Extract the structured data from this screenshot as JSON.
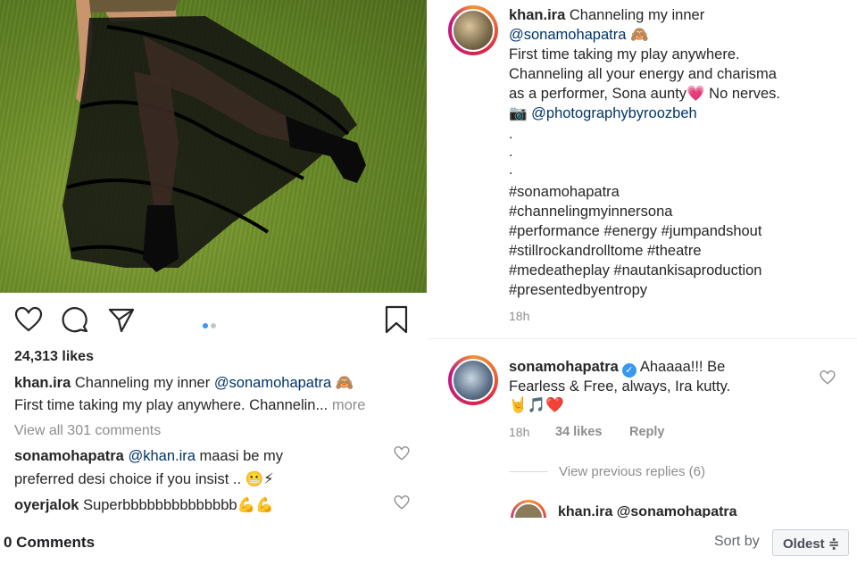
{
  "post": {
    "likes": "24,313 likes",
    "username": "khan.ira",
    "caption_start": "Channeling my inner",
    "caption_mention": "@sonamohapatra",
    "caption_emoji": "🙈",
    "caption_line2": "First time taking my play anywhere. Channelin...",
    "more_label": "more",
    "view_all": "View all 301 comments",
    "comments": [
      {
        "user": "sonamohapatra",
        "mention": "@khan.ira",
        "text": "maasi be my",
        "text2": "preferred desi choice if you insist ..",
        "emoji": "😬⚡"
      },
      {
        "user": "oyerjalok",
        "text": "Superbbbbbbbbbbbbbb",
        "emoji": "💪💪"
      }
    ],
    "icons": [
      "heart-icon",
      "comment-icon",
      "share-icon",
      "bookmark-icon"
    ],
    "accent_color": "#3897f0"
  },
  "caption_panel": {
    "username": "khan.ira",
    "line1": "Channeling my inner",
    "line2_mention": "@sonamohapatra",
    "line2_emoji": "🙈",
    "line3": "First time taking my play anywhere.",
    "line4": "Channeling all your energy and charisma",
    "line5": "as a performer, Sona aunty",
    "line5_emoji": "💗",
    "line5_end": "No nerves.",
    "line6_emoji": "📷",
    "line6_mention": "@photographybyroozbeh",
    "dots": [
      ".",
      ".",
      "."
    ],
    "hashtags": [
      "#sonamohapatra",
      "#channelingmyinnersona",
      "#performance #energy #jumpandshout",
      "#stillrockandrolltome #theatre",
      "#medeatheplay #nautankisaproduction",
      "#presentedbyentropy"
    ],
    "time": "18h"
  },
  "reply": {
    "username": "sonamohapatra",
    "text1": "Ahaaaa!!! Be",
    "text2": "Fearless & Free, always, Ira kutty.",
    "emojis": "🤘🎵❤️",
    "time": "18h",
    "likes": "34 likes",
    "reply_label": "Reply",
    "view_previous": "View previous replies (6)",
    "cut_text": "khan.ira @sonamohapatra"
  },
  "footer": {
    "comments_count": "0 Comments",
    "sort_by": "Sort by",
    "sort_value": "Oldest ≑"
  }
}
